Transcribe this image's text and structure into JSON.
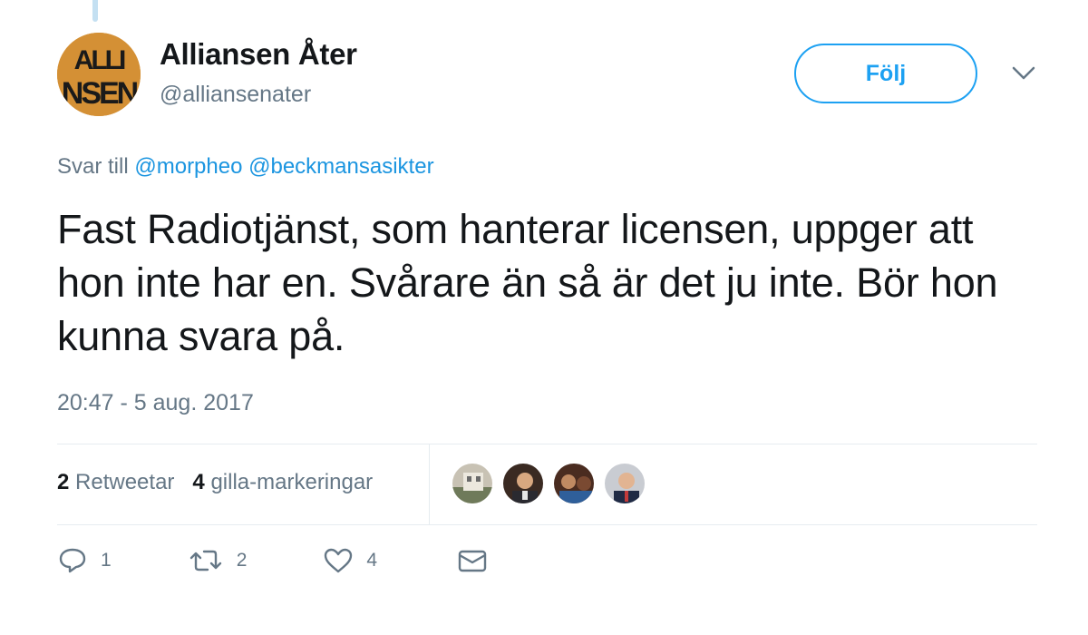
{
  "tweet": {
    "author_name": "Alliansen Åter",
    "author_handle": "@alliansenater",
    "follow_label": "Följ",
    "reply_prefix": "Svar till",
    "reply_mentions": [
      "@morpheo",
      "@beckmansasikter"
    ],
    "text": "Fast Radiotjänst, som hanterar licensen, uppger att hon inte har en. Svårare än så är det ju inte. Bör hon kunna svara på.",
    "timestamp": "20:47 - 5 aug. 2017",
    "avatar_text": "ALLIANSEN"
  },
  "stats": {
    "retweets_count": "2",
    "retweets_label": "Retweetar",
    "likes_count": "4",
    "likes_label": "gilla-markeringar"
  },
  "actions": {
    "reply_count": "1",
    "retweet_count": "2",
    "like_count": "4",
    "icons": [
      "reply-icon",
      "retweet-icon",
      "like-icon",
      "message-icon"
    ]
  },
  "colors": {
    "accent": "#1da1f2",
    "mention": "#1b95e0",
    "secondary_text": "#657786",
    "avatar_bg": "#d49035",
    "divider": "#e6ecf0"
  }
}
